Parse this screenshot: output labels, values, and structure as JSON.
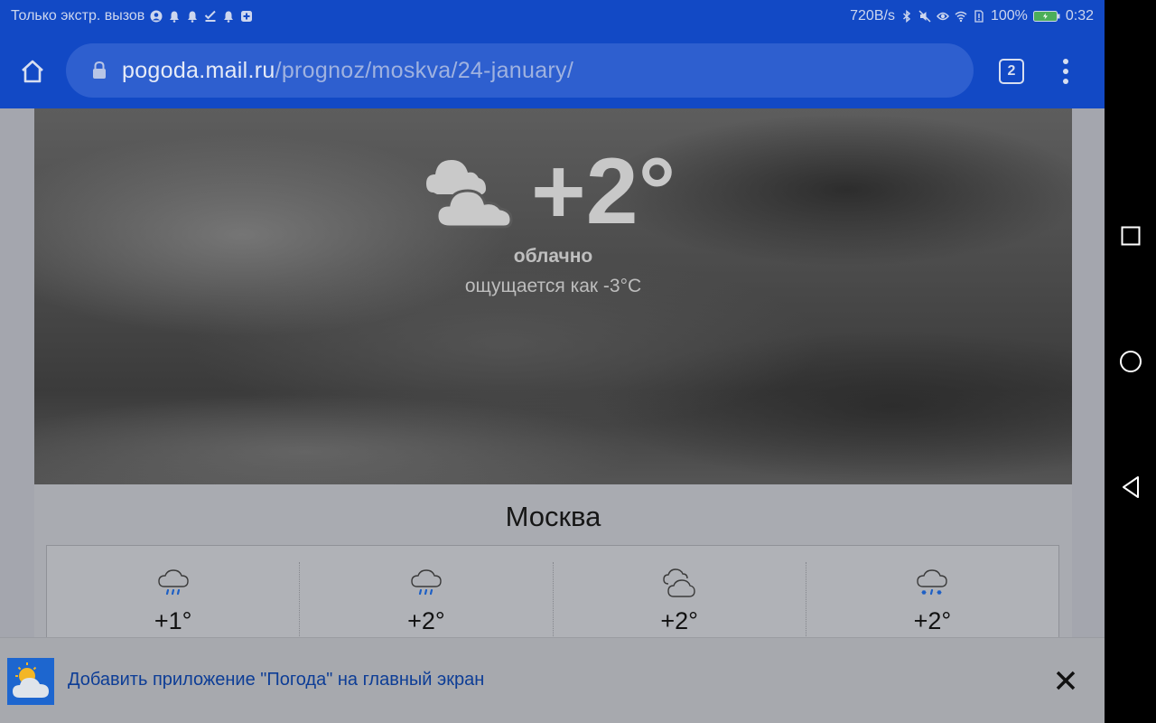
{
  "status_bar": {
    "left_text": "Только экстр. вызов",
    "net_speed": "720B/s",
    "battery": "100%",
    "time": "0:32"
  },
  "browser": {
    "url_host": "pogoda.mail.ru",
    "url_path": "/prognoz/moskva/24-january/",
    "tab_count": "2"
  },
  "weather": {
    "temp": "+2°",
    "condition": "облачно",
    "feels_like": "ощущается как -3°C",
    "city": "Москва",
    "forecast": [
      {
        "temp": "+1°",
        "icon": "rain-cloud-icon"
      },
      {
        "temp": "+2°",
        "icon": "rain-cloud-icon"
      },
      {
        "temp": "+2°",
        "icon": "cloudy-icon"
      },
      {
        "temp": "+2°",
        "icon": "sleet-cloud-icon"
      }
    ]
  },
  "banner": {
    "text": "Добавить приложение \"Погода\" на главный экран"
  },
  "colors": {
    "browser_bar": "#1249c5",
    "link_text": "#0d3d96",
    "banner_icon": "#1d66cf"
  }
}
